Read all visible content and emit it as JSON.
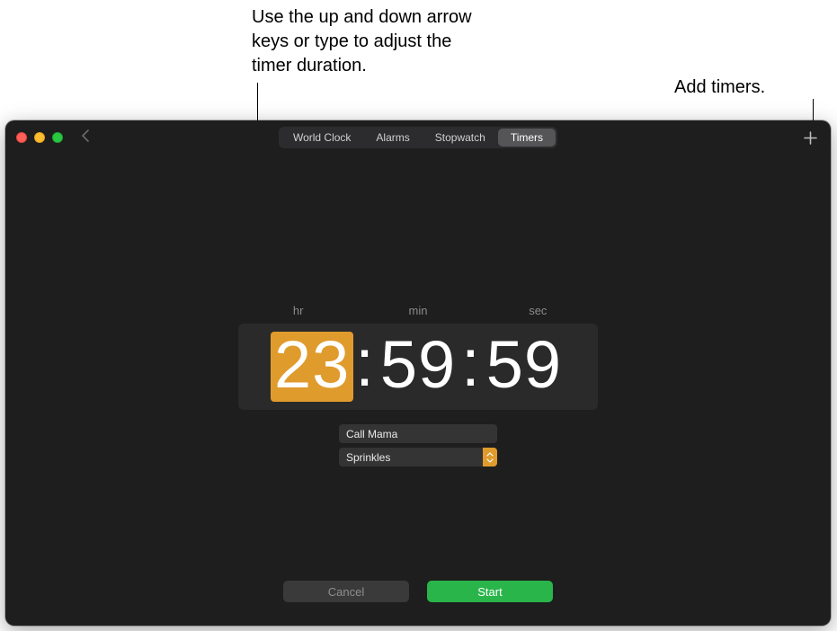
{
  "annotations": {
    "duration": "Use the up and down arrow keys or type to adjust the timer duration.",
    "add": "Add timers."
  },
  "tabs": {
    "t0": "World Clock",
    "t1": "Alarms",
    "t2": "Stopwatch",
    "t3": "Timers"
  },
  "labels": {
    "hr": "hr",
    "min": "min",
    "sec": "sec"
  },
  "timer": {
    "hours": "23",
    "minutes": "59",
    "seconds": "59",
    "label_value": "Call Mama",
    "sound_value": "Sprinkles"
  },
  "buttons": {
    "cancel": "Cancel",
    "start": "Start"
  }
}
